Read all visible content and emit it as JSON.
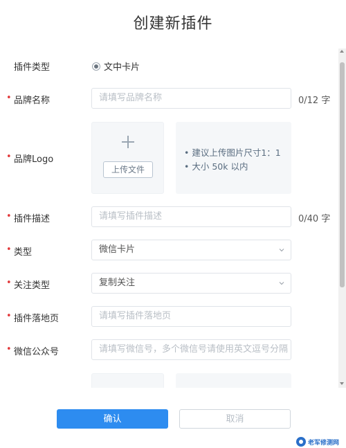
{
  "dialog": {
    "title": "创建新插件"
  },
  "form": {
    "plugin_type": {
      "label": "插件类型",
      "option": "文中卡片"
    },
    "brand_name": {
      "label": "品牌名称",
      "placeholder": "请填写品牌名称",
      "counter": "0/12 字"
    },
    "brand_logo": {
      "label": "品牌Logo",
      "upload_button": "上传文件",
      "hints": [
        "• 建议上传图片尺寸1：1",
        "• 大小 50k 以内"
      ]
    },
    "plugin_desc": {
      "label": "插件描述",
      "placeholder": "请填写插件描述",
      "counter": "0/40 字"
    },
    "type": {
      "label": "类型",
      "value": "微信卡片"
    },
    "follow_type": {
      "label": "关注类型",
      "value": "复制关注"
    },
    "landing_page": {
      "label": "插件落地页",
      "placeholder": "请填写插件落地页"
    },
    "wechat_account": {
      "label": "微信公众号",
      "placeholder": "请填写微信号，多个微信号请使用英文逗号分隔"
    }
  },
  "footer": {
    "confirm": "确认",
    "cancel": "取消"
  },
  "watermark": {
    "text": "老军修测网"
  },
  "colors": {
    "primary": "#2d8cf0",
    "required": "#e2393b",
    "hint_bg": "#f5f7f9"
  }
}
